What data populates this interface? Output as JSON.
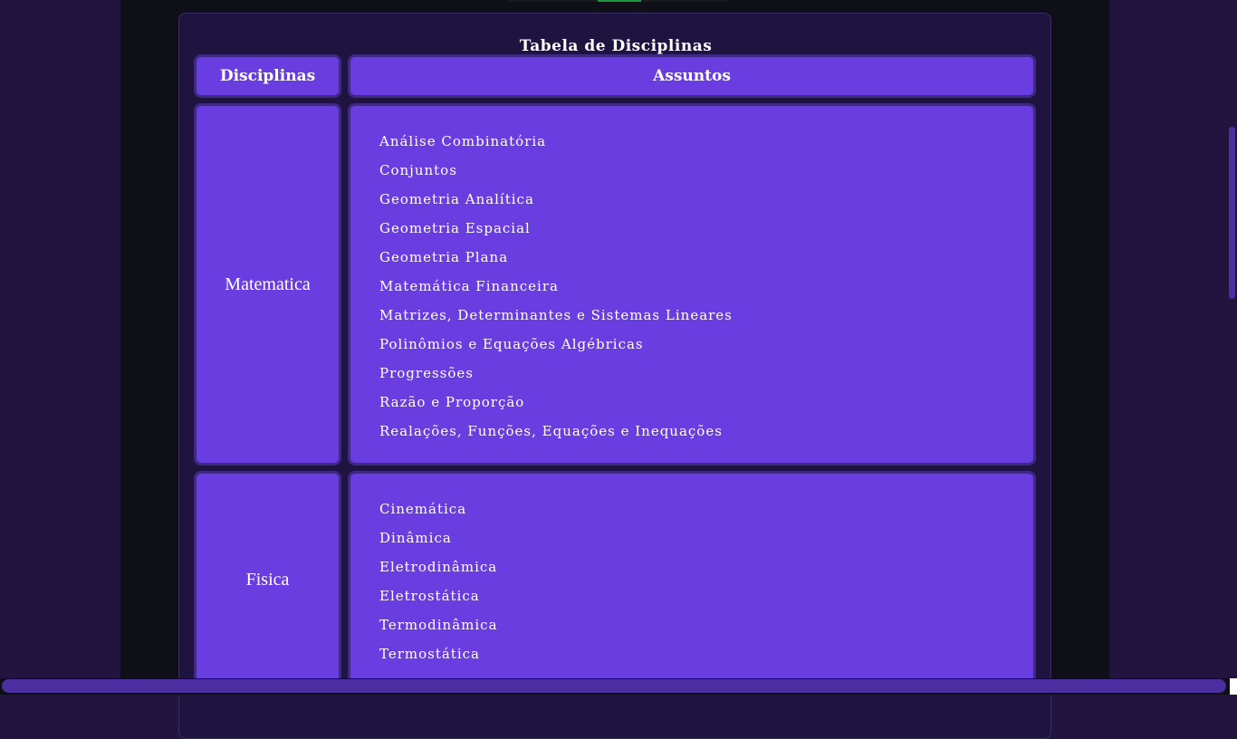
{
  "table": {
    "title": "Tabela de Disciplinas",
    "headers": {
      "subject": "Disciplinas",
      "topics": "Assuntos"
    },
    "rows": [
      {
        "subject": "Matematica",
        "topics": [
          "Análise Combinatória",
          "Conjuntos",
          "Geometria Analítica",
          "Geometria Espacial",
          "Geometria Plana",
          "Matemática Financeira",
          "Matrizes, Determinantes e Sistemas Lineares",
          "Polinômios e Equações Algébricas",
          "Progressões",
          "Razão e Proporção",
          "Realações, Funções, Equações e Inequações"
        ]
      },
      {
        "subject": "Fisica",
        "topics": [
          "Cinemática",
          "Dinâmica",
          "Eletrodinâmica",
          "Eletrostática",
          "Termodinâmica",
          "Termostática"
        ]
      }
    ]
  },
  "colors": {
    "page_background": "#21143f",
    "center_column": "#0f0f17",
    "panel_background": "#1f1340",
    "cell_background": "#6a3de0",
    "cell_border": "#3e2a86",
    "scrollbar_thumb": "#4b2fa0",
    "text": "#ffffff"
  }
}
